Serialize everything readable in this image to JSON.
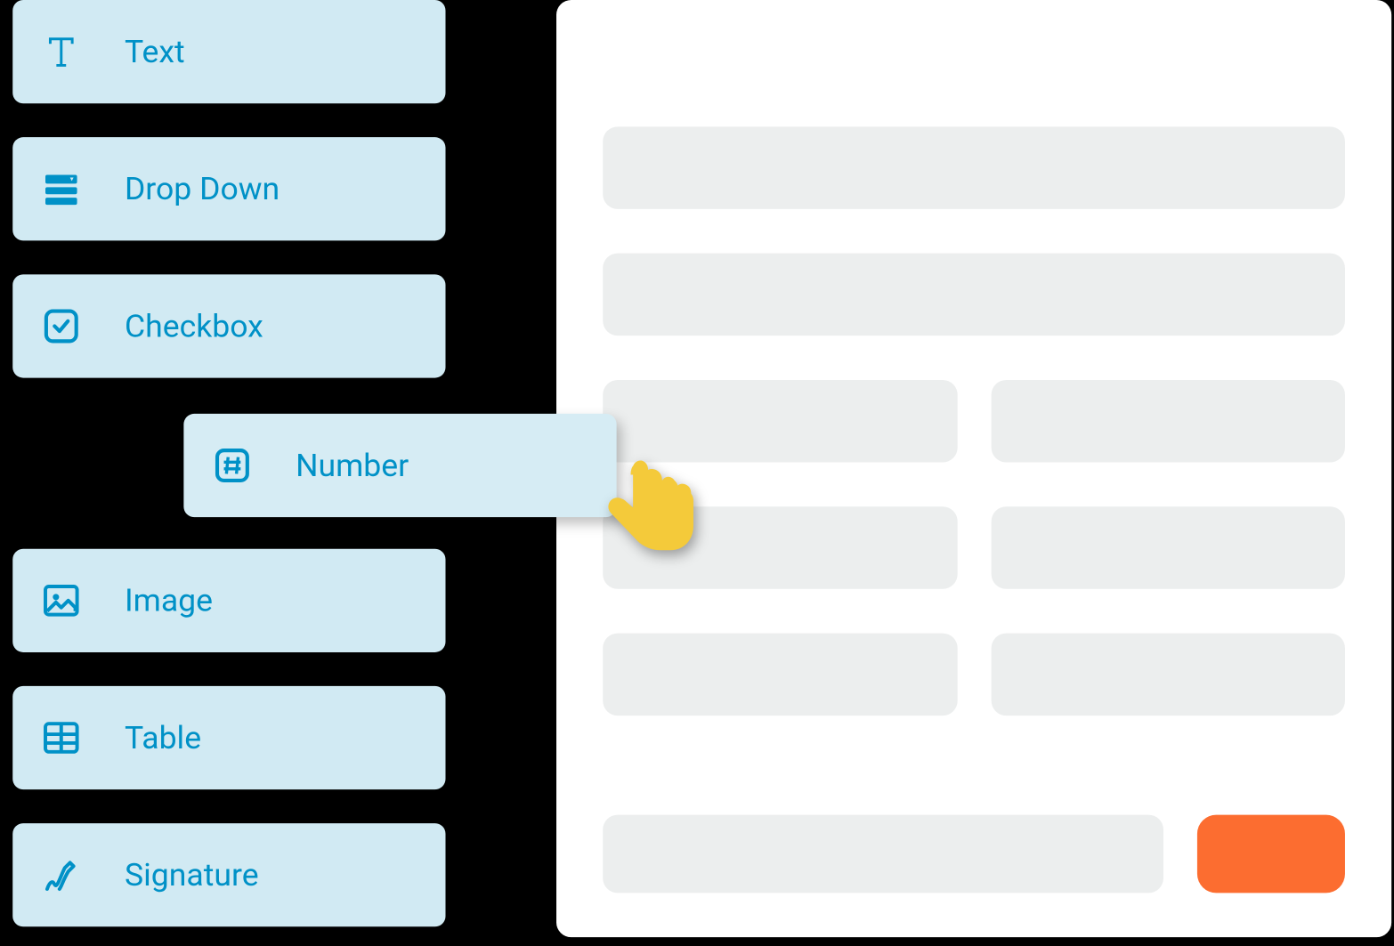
{
  "sidebar": {
    "items": [
      {
        "label": "Text",
        "icon": "text-icon"
      },
      {
        "label": "Drop Down",
        "icon": "dropdown-icon"
      },
      {
        "label": "Checkbox",
        "icon": "checkbox-icon"
      },
      {
        "label": "Image",
        "icon": "image-icon"
      },
      {
        "label": "Table",
        "icon": "table-icon"
      },
      {
        "label": "Signature",
        "icon": "signature-icon"
      }
    ]
  },
  "dragging": {
    "label": "Number",
    "icon": "number-icon"
  },
  "colors": {
    "accent": "#0091c7",
    "item_bg": "#d1eaf3",
    "canvas_bg": "#ffffff",
    "placeholder": "#eceeee",
    "submit": "#fc6d30",
    "cursor": "#f4ca3a"
  }
}
